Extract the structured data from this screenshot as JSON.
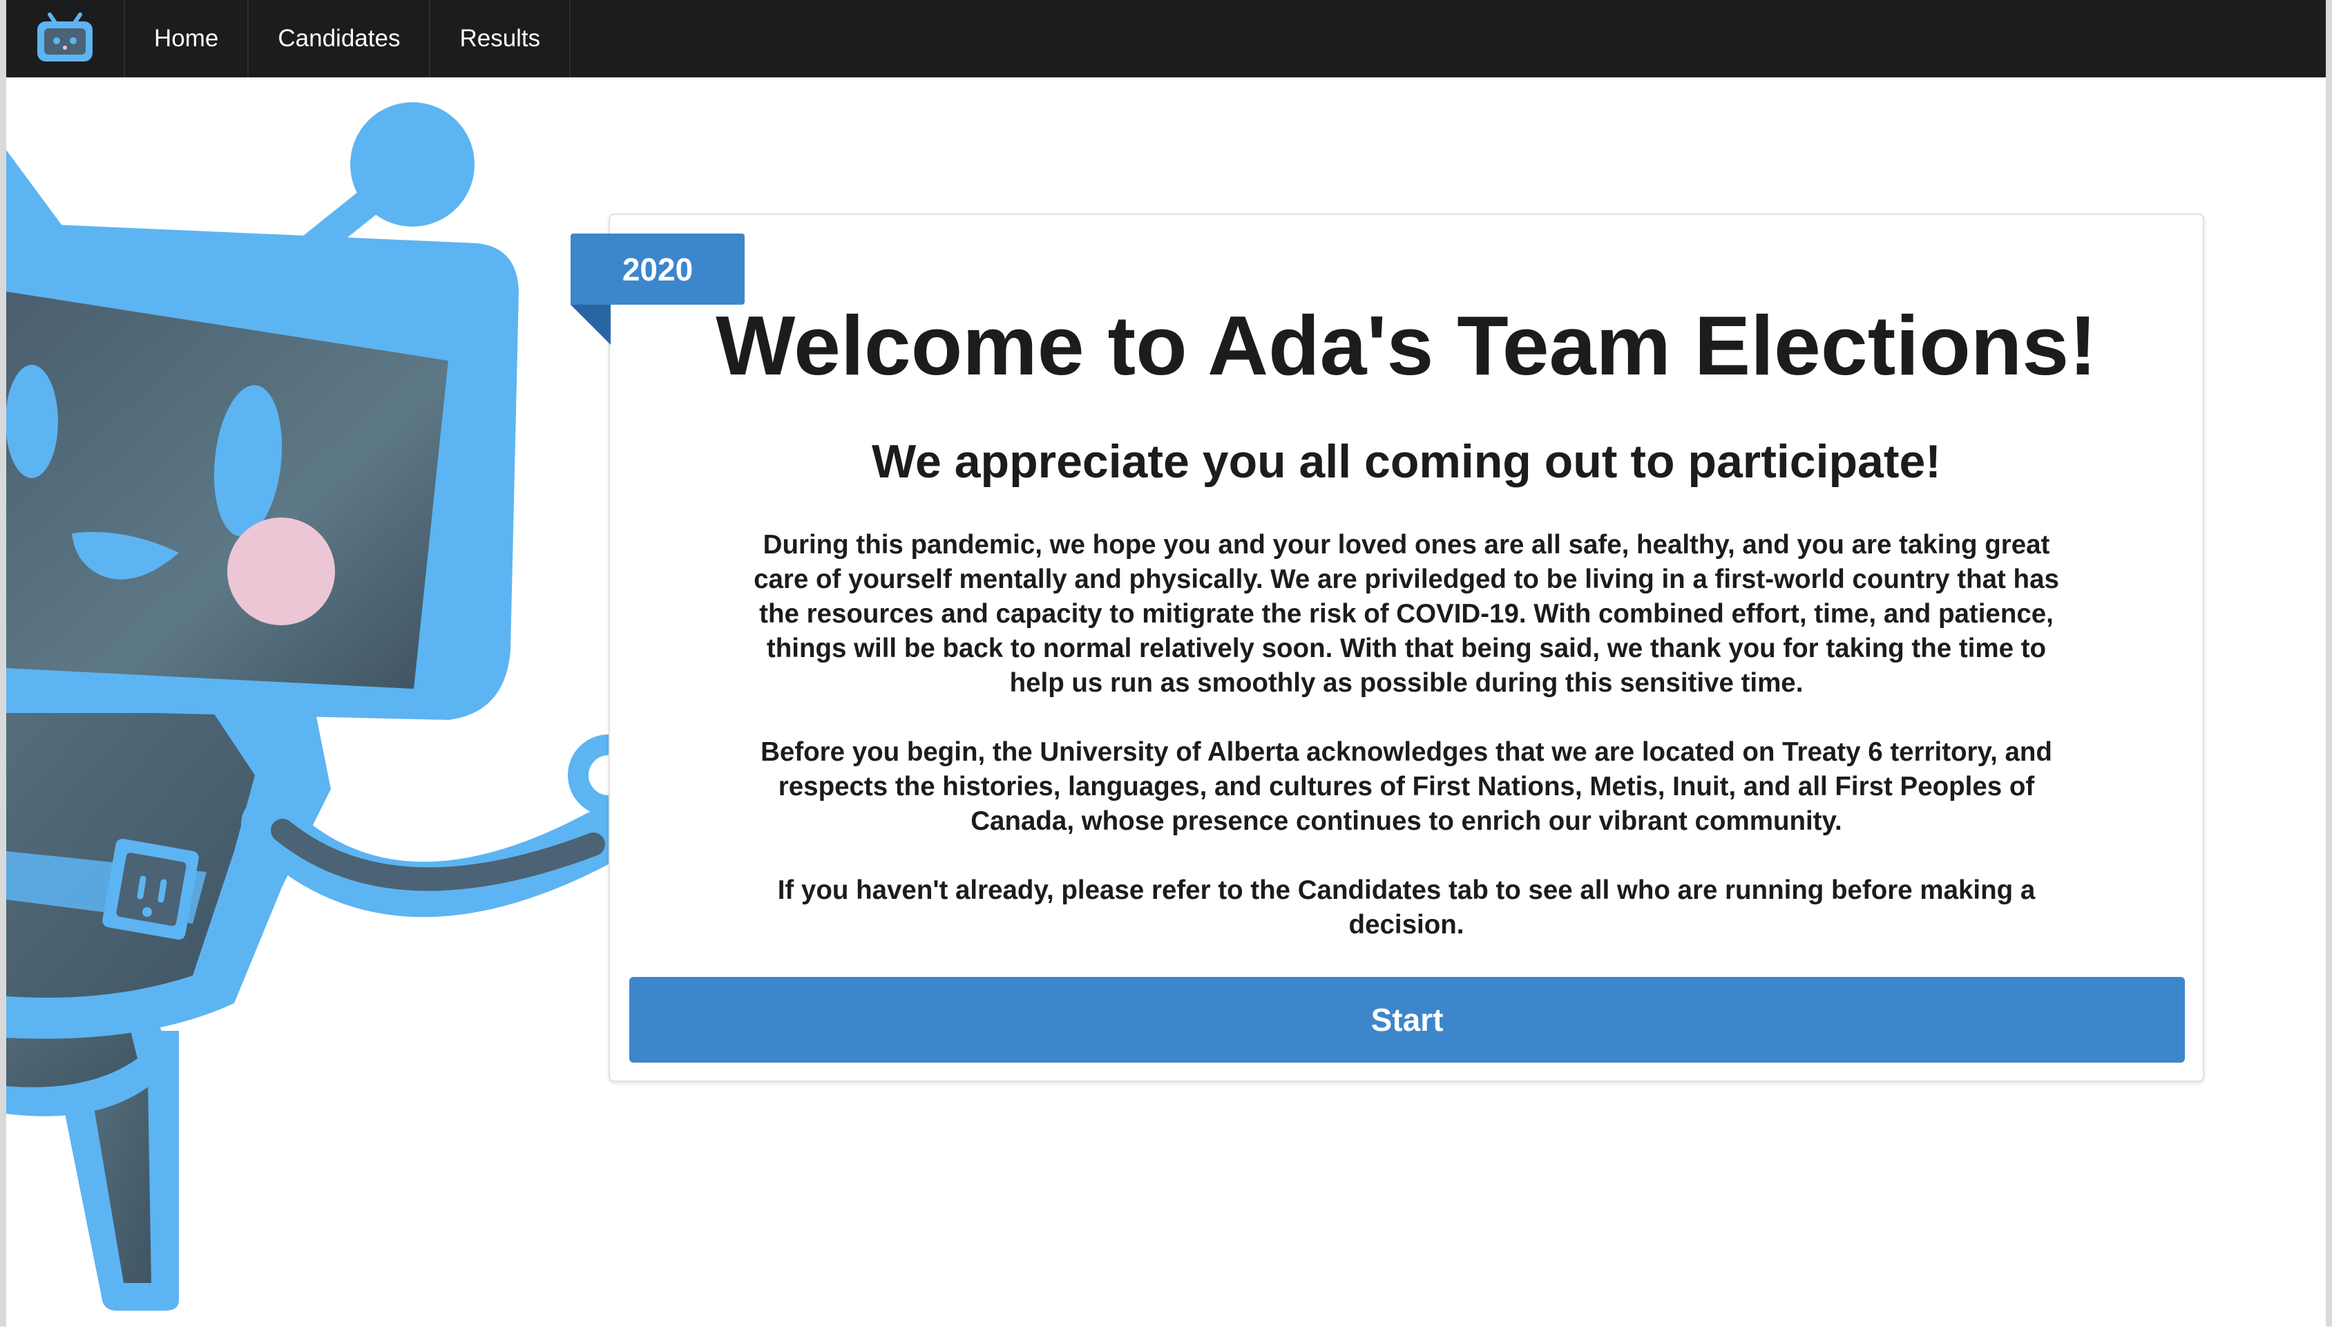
{
  "navbar": {
    "logo_icon": "robot-logo-icon",
    "items": [
      {
        "label": "Home"
      },
      {
        "label": "Candidates"
      },
      {
        "label": "Results"
      }
    ]
  },
  "card": {
    "year_badge": "2020",
    "title": "Welcome to Ada's Team Elections!",
    "subtitle": "We appreciate you all coming out to participate!",
    "paragraphs": [
      "During this pandemic, we hope you and your loved ones are all safe, healthy, and you are taking great care of yourself mentally and physically. We are priviledged to be living in a first-world country that has the resources and capacity to mitigrate the risk of COVID-19. With combined effort, time, and patience, things will be back to normal relatively soon. With that being said, we thank you for taking the time to help us run as smoothly as possible during this sensitive time.",
      "Before you begin, the University of Alberta acknowledges that we are located on Treaty 6 territory, and respects the histories, languages, and cultures of First Nations, Metis, Inuit, and all First Peoples of Canada, whose presence continues to enrich our vibrant community.",
      "If you haven't already, please refer to the Candidates tab to see all who are running before making a decision."
    ],
    "start_label": "Start"
  },
  "colors": {
    "navbar_bg": "#1b1c1d",
    "accent_blue": "#3d86cb",
    "robot_blue": "#5db4f2",
    "robot_screen": "#4b6374",
    "robot_blush": "#ecc6d4"
  }
}
